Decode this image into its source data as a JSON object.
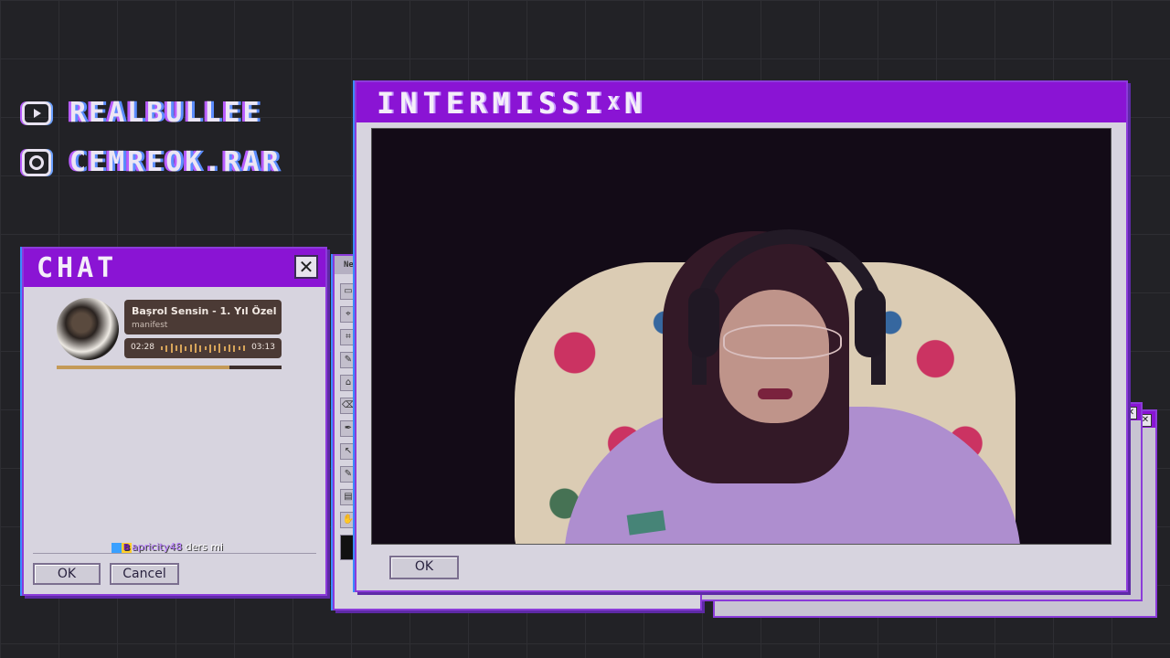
{
  "socials": [
    {
      "icon": "youtube-icon",
      "label": "REALBULLEE"
    },
    {
      "icon": "instagram-icon",
      "label": "CEMREOK.RAR"
    }
  ],
  "chat_window": {
    "title": "CHAT",
    "close_label": "✕",
    "now_playing": {
      "title": "Başrol Sensin - 1. Yıl Özel",
      "artist": "manifest",
      "elapsed": "02:28",
      "duration": "03:13",
      "progress": 0.77
    },
    "messages": [
      {
        "user": "apricity48",
        "text": "ders mi"
      }
    ],
    "ok_label": "OK",
    "cancel_label": "Cancel"
  },
  "paint_window": {
    "title": "Ne",
    "tools": [
      "▭",
      "⌖",
      "⌗",
      "✎",
      "⌂",
      "⌫",
      "✒",
      "↖",
      "✎",
      "▤",
      "✋"
    ]
  },
  "main_window": {
    "title": "INTERMISSI",
    "title_glitch": "X",
    "title_end": "N",
    "ok_label": "OK"
  },
  "colors": {
    "accent": "#8a14d4",
    "window_bg": "#d7d4df",
    "background": "#222226"
  }
}
